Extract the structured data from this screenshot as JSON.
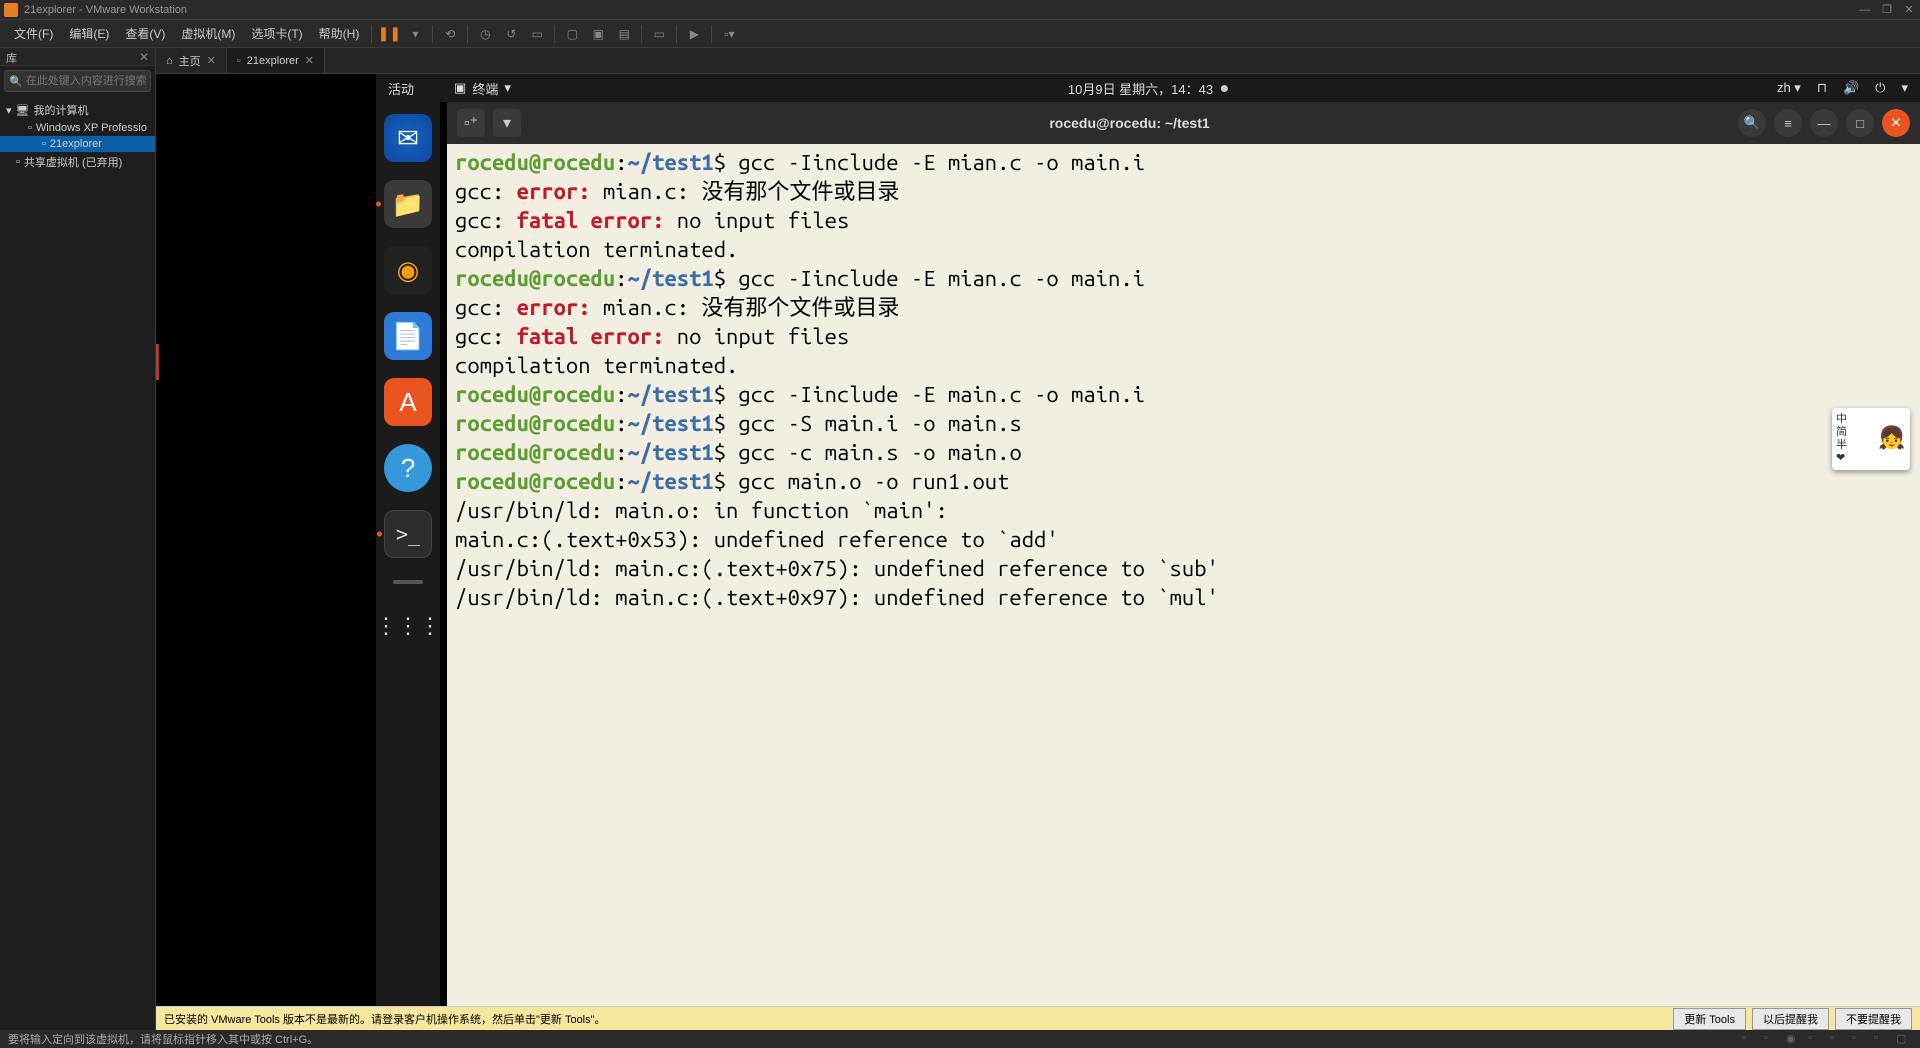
{
  "titlebar": {
    "title": "21explorer - VMware Workstation"
  },
  "menu": {
    "file": "文件(F)",
    "edit": "编辑(E)",
    "view": "查看(V)",
    "vm": "虚拟机(M)",
    "tabs": "选项卡(T)",
    "help": "帮助(H)"
  },
  "sidebar": {
    "header": "库",
    "search_placeholder": "在此处键入内容进行搜索",
    "items": {
      "root": "我的计算机",
      "xp": "Windows XP Professio",
      "explorer": "21explorer",
      "shared": "共享虚拟机 (已弃用)"
    }
  },
  "content_tabs": {
    "home": "主页",
    "vm": "21explorer"
  },
  "ubuntu_top": {
    "activities": "活动",
    "terminal_label": "终端",
    "datetime": "10月9日 星期六，14：43",
    "lang": "zh"
  },
  "terminal": {
    "title": "rocedu@rocedu: ~/test1",
    "prompt_user": "rocedu@rocedu",
    "prompt_path": "~/test1",
    "cmd1": " gcc -Iinclude -E mian.c -o main.i",
    "err1a": "gcc: ",
    "err1b": "error: ",
    "err1c": "mian.c: 没有那个文件或目录",
    "err2a": "gcc: ",
    "err2b": "fatal error: ",
    "err2c": "no input files",
    "err3": "compilation terminated.",
    "cmd2": " gcc -Iinclude -E mian.c -o main.i",
    "cmd3": " gcc -Iinclude -E main.c -o main.i",
    "cmd4": " gcc -S main.i -o main.s",
    "cmd5": " gcc -c main.s -o main.o",
    "cmd6": " gcc main.o -o run1.out",
    "ld1": "/usr/bin/ld: main.o: in function `main':",
    "ld2": "main.c:(.text+0x53): undefined reference to `add'",
    "ld3": "/usr/bin/ld: main.c:(.text+0x75): undefined reference to `sub'",
    "ld4": "/usr/bin/ld: main.c:(.text+0x97): undefined reference to `mul'"
  },
  "info_bar": {
    "msg": "已安装的 VMware Tools 版本不是最新的。请登录客户机操作系统，然后单击\"更新 Tools\"。",
    "btn_update": "更新 Tools",
    "btn_later": "以后提醒我",
    "btn_never": "不要提醒我"
  },
  "statusbar": {
    "msg": "要将输入定向到该虚拟机，请将鼠标指针移入其中或按 Ctrl+G。"
  },
  "ime": {
    "lines": "中\n简\n半\n❤"
  }
}
